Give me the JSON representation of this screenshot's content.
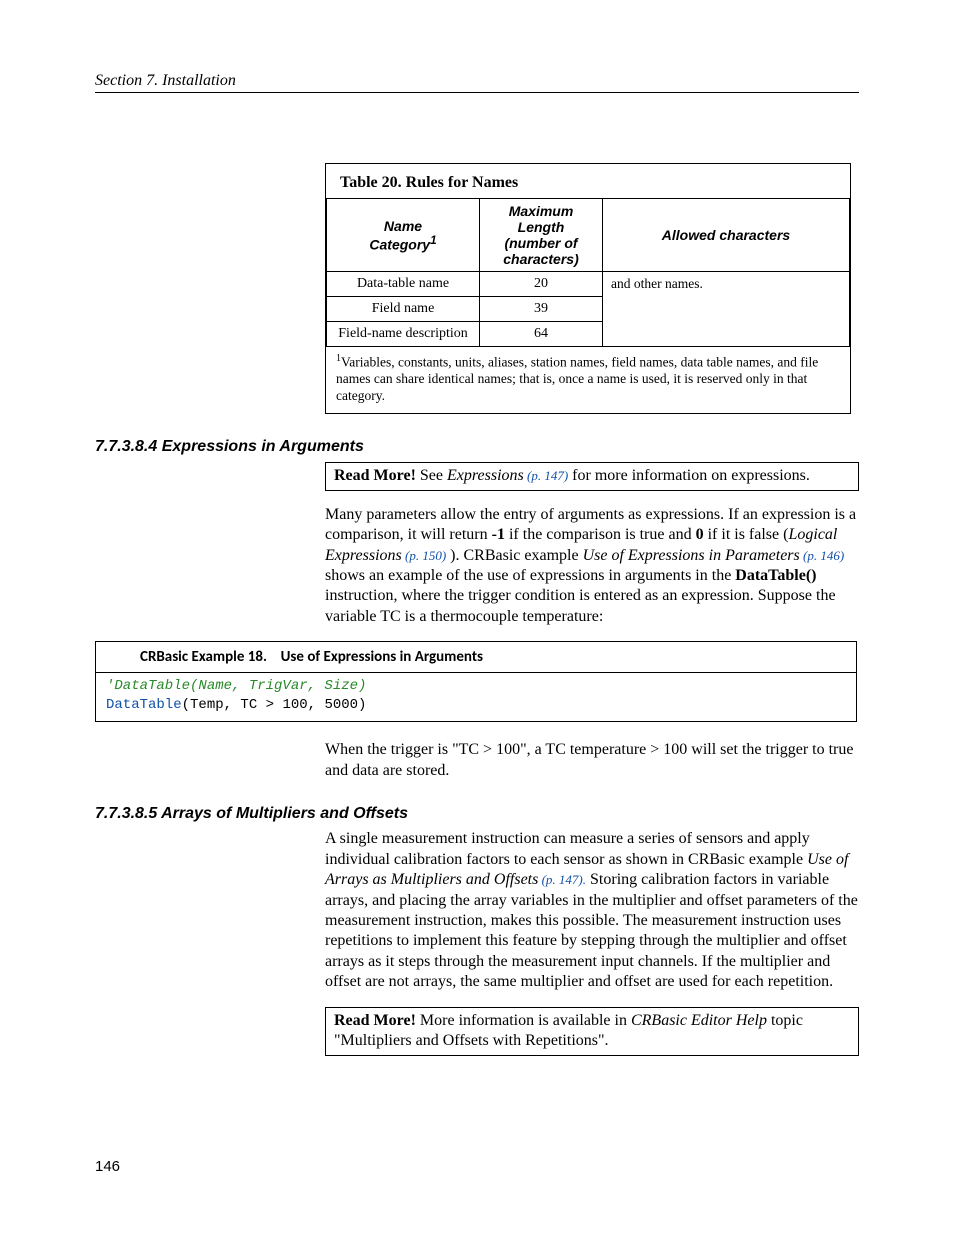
{
  "header": {
    "text": "Section 7.  Installation"
  },
  "page_number": "146",
  "table": {
    "title": "Table 20. Rules for Names",
    "columns": {
      "c1_line1": "Name",
      "c1_line2": "Category",
      "c1_sup": "1",
      "c2_line1": "Maximum Length",
      "c2_line2": "(number of",
      "c2_line3": "characters)",
      "c3": "Allowed characters"
    },
    "rows": [
      {
        "c1": "Data-table name",
        "c2": "20"
      },
      {
        "c1": "Field name",
        "c2": "39"
      },
      {
        "c1": "Field-name description",
        "c2": "64"
      }
    ],
    "c3_merged": "and other names.",
    "footnote_sup": "1",
    "footnote": "Variables, constants, units, aliases, station names, field names, data table names, and file names can share identical names; that is, once a name is used, it is reserved only in that category."
  },
  "section1": {
    "heading": "7.7.3.8.4 Expressions in Arguments",
    "readmore_label": "Read More!",
    "readmore_text1": " See ",
    "readmore_ital": "Expressions",
    "readmore_link": " (p. 147)",
    "readmore_text2": " for more information on expressions.",
    "para1a": "Many parameters allow the entry of arguments as expressions. If an expression is a comparison, it will return ",
    "para1b": "-1",
    "para1c": " if the comparison is true and ",
    "para1d": "0",
    "para1e": " if it is false (",
    "para1f": "Logical Expressions",
    "para1g": " (p. 150)",
    "para1h": " ). CRBasic example ",
    "para1i": "Use of Expressions in Parameters",
    "para1j": " (p. 146)",
    "para1k": " shows an example of the use of expressions in arguments in the ",
    "para1l": "DataTable()",
    "para1m": " instruction, where the trigger condition is entered as an expression. Suppose the variable TC is a thermocouple temperature:"
  },
  "code_example": {
    "title_prefix": "CRBasic Example 18.",
    "title_rest": "Use of Expressions in Arguments",
    "line1": "'DataTable(Name, TrigVar, Size)",
    "line2_kw": "DataTable",
    "line2_rest": "(Temp, TC > 100, 5000)"
  },
  "section1b": {
    "para": "When the trigger is \"TC > 100\", a TC temperature > 100 will set the trigger to true and data are stored."
  },
  "section2": {
    "heading": "7.7.3.8.5 Arrays of Multipliers and Offsets",
    "para1a": "A single measurement instruction can measure a series of sensors and apply individual calibration factors to each sensor as shown in CRBasic example ",
    "para1b": "Use of Arrays as Multipliers and Offsets",
    "para1c": " (p. 147).",
    "para1d": " Storing calibration factors in variable arrays, and placing the array variables in the multiplier and offset parameters of the measurement instruction, makes this possible. The measurement instruction uses repetitions to implement this feature by stepping through the multiplier and offset arrays as it steps through the measurement input channels. If the multiplier and offset are not arrays, the same multiplier and offset are used for each repetition.",
    "readmore_label": "Read More!",
    "readmore_text1": " More information is available in ",
    "readmore_ital": "CRBasic Editor Help",
    "readmore_text2": " topic \"Multipliers and Offsets with Repetitions\"."
  }
}
